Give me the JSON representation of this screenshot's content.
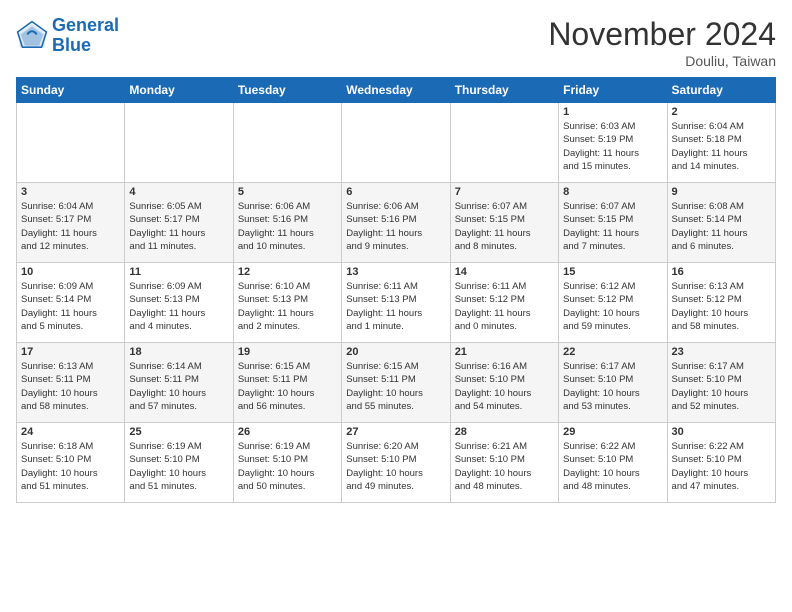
{
  "header": {
    "logo_line1": "General",
    "logo_line2": "Blue",
    "month": "November 2024",
    "location": "Douliu, Taiwan"
  },
  "weekdays": [
    "Sunday",
    "Monday",
    "Tuesday",
    "Wednesday",
    "Thursday",
    "Friday",
    "Saturday"
  ],
  "weeks": [
    [
      {
        "day": "",
        "info": ""
      },
      {
        "day": "",
        "info": ""
      },
      {
        "day": "",
        "info": ""
      },
      {
        "day": "",
        "info": ""
      },
      {
        "day": "",
        "info": ""
      },
      {
        "day": "1",
        "info": "Sunrise: 6:03 AM\nSunset: 5:19 PM\nDaylight: 11 hours\nand 15 minutes."
      },
      {
        "day": "2",
        "info": "Sunrise: 6:04 AM\nSunset: 5:18 PM\nDaylight: 11 hours\nand 14 minutes."
      }
    ],
    [
      {
        "day": "3",
        "info": "Sunrise: 6:04 AM\nSunset: 5:17 PM\nDaylight: 11 hours\nand 12 minutes."
      },
      {
        "day": "4",
        "info": "Sunrise: 6:05 AM\nSunset: 5:17 PM\nDaylight: 11 hours\nand 11 minutes."
      },
      {
        "day": "5",
        "info": "Sunrise: 6:06 AM\nSunset: 5:16 PM\nDaylight: 11 hours\nand 10 minutes."
      },
      {
        "day": "6",
        "info": "Sunrise: 6:06 AM\nSunset: 5:16 PM\nDaylight: 11 hours\nand 9 minutes."
      },
      {
        "day": "7",
        "info": "Sunrise: 6:07 AM\nSunset: 5:15 PM\nDaylight: 11 hours\nand 8 minutes."
      },
      {
        "day": "8",
        "info": "Sunrise: 6:07 AM\nSunset: 5:15 PM\nDaylight: 11 hours\nand 7 minutes."
      },
      {
        "day": "9",
        "info": "Sunrise: 6:08 AM\nSunset: 5:14 PM\nDaylight: 11 hours\nand 6 minutes."
      }
    ],
    [
      {
        "day": "10",
        "info": "Sunrise: 6:09 AM\nSunset: 5:14 PM\nDaylight: 11 hours\nand 5 minutes."
      },
      {
        "day": "11",
        "info": "Sunrise: 6:09 AM\nSunset: 5:13 PM\nDaylight: 11 hours\nand 4 minutes."
      },
      {
        "day": "12",
        "info": "Sunrise: 6:10 AM\nSunset: 5:13 PM\nDaylight: 11 hours\nand 2 minutes."
      },
      {
        "day": "13",
        "info": "Sunrise: 6:11 AM\nSunset: 5:13 PM\nDaylight: 11 hours\nand 1 minute."
      },
      {
        "day": "14",
        "info": "Sunrise: 6:11 AM\nSunset: 5:12 PM\nDaylight: 11 hours\nand 0 minutes."
      },
      {
        "day": "15",
        "info": "Sunrise: 6:12 AM\nSunset: 5:12 PM\nDaylight: 10 hours\nand 59 minutes."
      },
      {
        "day": "16",
        "info": "Sunrise: 6:13 AM\nSunset: 5:12 PM\nDaylight: 10 hours\nand 58 minutes."
      }
    ],
    [
      {
        "day": "17",
        "info": "Sunrise: 6:13 AM\nSunset: 5:11 PM\nDaylight: 10 hours\nand 58 minutes."
      },
      {
        "day": "18",
        "info": "Sunrise: 6:14 AM\nSunset: 5:11 PM\nDaylight: 10 hours\nand 57 minutes."
      },
      {
        "day": "19",
        "info": "Sunrise: 6:15 AM\nSunset: 5:11 PM\nDaylight: 10 hours\nand 56 minutes."
      },
      {
        "day": "20",
        "info": "Sunrise: 6:15 AM\nSunset: 5:11 PM\nDaylight: 10 hours\nand 55 minutes."
      },
      {
        "day": "21",
        "info": "Sunrise: 6:16 AM\nSunset: 5:10 PM\nDaylight: 10 hours\nand 54 minutes."
      },
      {
        "day": "22",
        "info": "Sunrise: 6:17 AM\nSunset: 5:10 PM\nDaylight: 10 hours\nand 53 minutes."
      },
      {
        "day": "23",
        "info": "Sunrise: 6:17 AM\nSunset: 5:10 PM\nDaylight: 10 hours\nand 52 minutes."
      }
    ],
    [
      {
        "day": "24",
        "info": "Sunrise: 6:18 AM\nSunset: 5:10 PM\nDaylight: 10 hours\nand 51 minutes."
      },
      {
        "day": "25",
        "info": "Sunrise: 6:19 AM\nSunset: 5:10 PM\nDaylight: 10 hours\nand 51 minutes."
      },
      {
        "day": "26",
        "info": "Sunrise: 6:19 AM\nSunset: 5:10 PM\nDaylight: 10 hours\nand 50 minutes."
      },
      {
        "day": "27",
        "info": "Sunrise: 6:20 AM\nSunset: 5:10 PM\nDaylight: 10 hours\nand 49 minutes."
      },
      {
        "day": "28",
        "info": "Sunrise: 6:21 AM\nSunset: 5:10 PM\nDaylight: 10 hours\nand 48 minutes."
      },
      {
        "day": "29",
        "info": "Sunrise: 6:22 AM\nSunset: 5:10 PM\nDaylight: 10 hours\nand 48 minutes."
      },
      {
        "day": "30",
        "info": "Sunrise: 6:22 AM\nSunset: 5:10 PM\nDaylight: 10 hours\nand 47 minutes."
      }
    ]
  ]
}
